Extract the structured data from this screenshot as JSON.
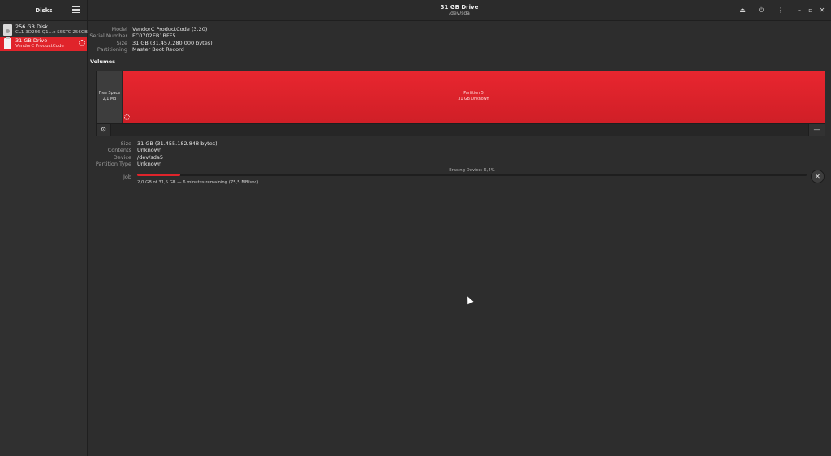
{
  "sidebar": {
    "title": "Disks",
    "disks": [
      {
        "title": "256 GB Disk",
        "subtitle": "CL1-3D256-Q1…e SSSTC 256GB"
      },
      {
        "title": "31 GB Drive",
        "subtitle": "VendorC ProductCode"
      }
    ]
  },
  "header": {
    "title": "31 GB Drive",
    "subtitle": "/dev/sda",
    "icons": [
      "eject-icon",
      "power-icon",
      "more-vertical-icon",
      "minimize-icon",
      "maximize-icon",
      "close-icon"
    ]
  },
  "drive_info": [
    {
      "label": "Model",
      "value": "VendorC ProductCode (3.20)"
    },
    {
      "label": "Serial Number",
      "value": "FC0702EB1BFF5"
    },
    {
      "label": "Size",
      "value": "31 GB (31.457.280.000 bytes)"
    },
    {
      "label": "Partitioning",
      "value": "Master Boot Record"
    }
  ],
  "volumes": {
    "title": "Volumes",
    "free_space": {
      "line1": "Free Space",
      "line2": "2,1 MB"
    },
    "partition": {
      "line1": "Partition 5",
      "line2": "31 GB Unknown"
    }
  },
  "partition_info": [
    {
      "label": "Size",
      "value": "31 GB (31.455.182.848 bytes)"
    },
    {
      "label": "Contents",
      "value": "Unknown"
    },
    {
      "label": "Device",
      "value": "/dev/sda5"
    },
    {
      "label": "Partition Type",
      "value": "Unknown"
    }
  ],
  "job": {
    "label": "Job",
    "status": "Erasing Device: 6,4%",
    "progress_percent": 6.4,
    "detail": "2,0 GB of 31,5 GB — 6 minutes remaining (75,5 MB/sec)"
  },
  "colors": {
    "accent": "#e0242b",
    "background": "#2d2d2d",
    "sidebar": "#303030"
  }
}
